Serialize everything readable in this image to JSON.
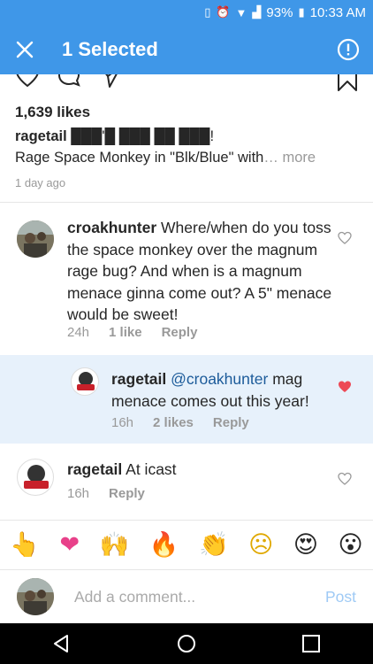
{
  "status_bar": {
    "battery": "93%",
    "time": "10:33 AM"
  },
  "app_bar": {
    "title": "1 Selected"
  },
  "post": {
    "likes": "1,639 likes",
    "author": "ragetail",
    "caption_line1_rest": "███'█ ███ ██ ███!",
    "caption_line2": "Rage Space Monkey in \"Blk/Blue\" with",
    "more_label": "… more",
    "time_ago": "1 day ago"
  },
  "comments": [
    {
      "author": "croakhunter",
      "text": "Where/when do you toss the space monkey over the magnum rage bug? And when is a magnum menace ginna come out? A 5\" menace would be sweet!",
      "time": "24h",
      "likes": "1 like",
      "reply_label": "Reply"
    },
    {
      "author": "ragetail",
      "mention": "@croakhunter",
      "text": "mag menace comes out this year!",
      "time": "16h",
      "likes": "2 likes",
      "reply_label": "Reply"
    },
    {
      "author": "ragetail",
      "text": "At icast",
      "time": "16h",
      "reply_label": "Reply"
    }
  ],
  "emoji_bar": [
    "👆",
    "❤",
    "🙌",
    "🔥",
    "👏",
    "☹",
    "😍",
    "😮"
  ],
  "comment_box": {
    "placeholder": "Add a comment...",
    "post_label": "Post"
  },
  "colors": {
    "accent": "#3f97e8",
    "selected_bg": "#e7f1fb",
    "liked_heart": "#ed4956"
  }
}
